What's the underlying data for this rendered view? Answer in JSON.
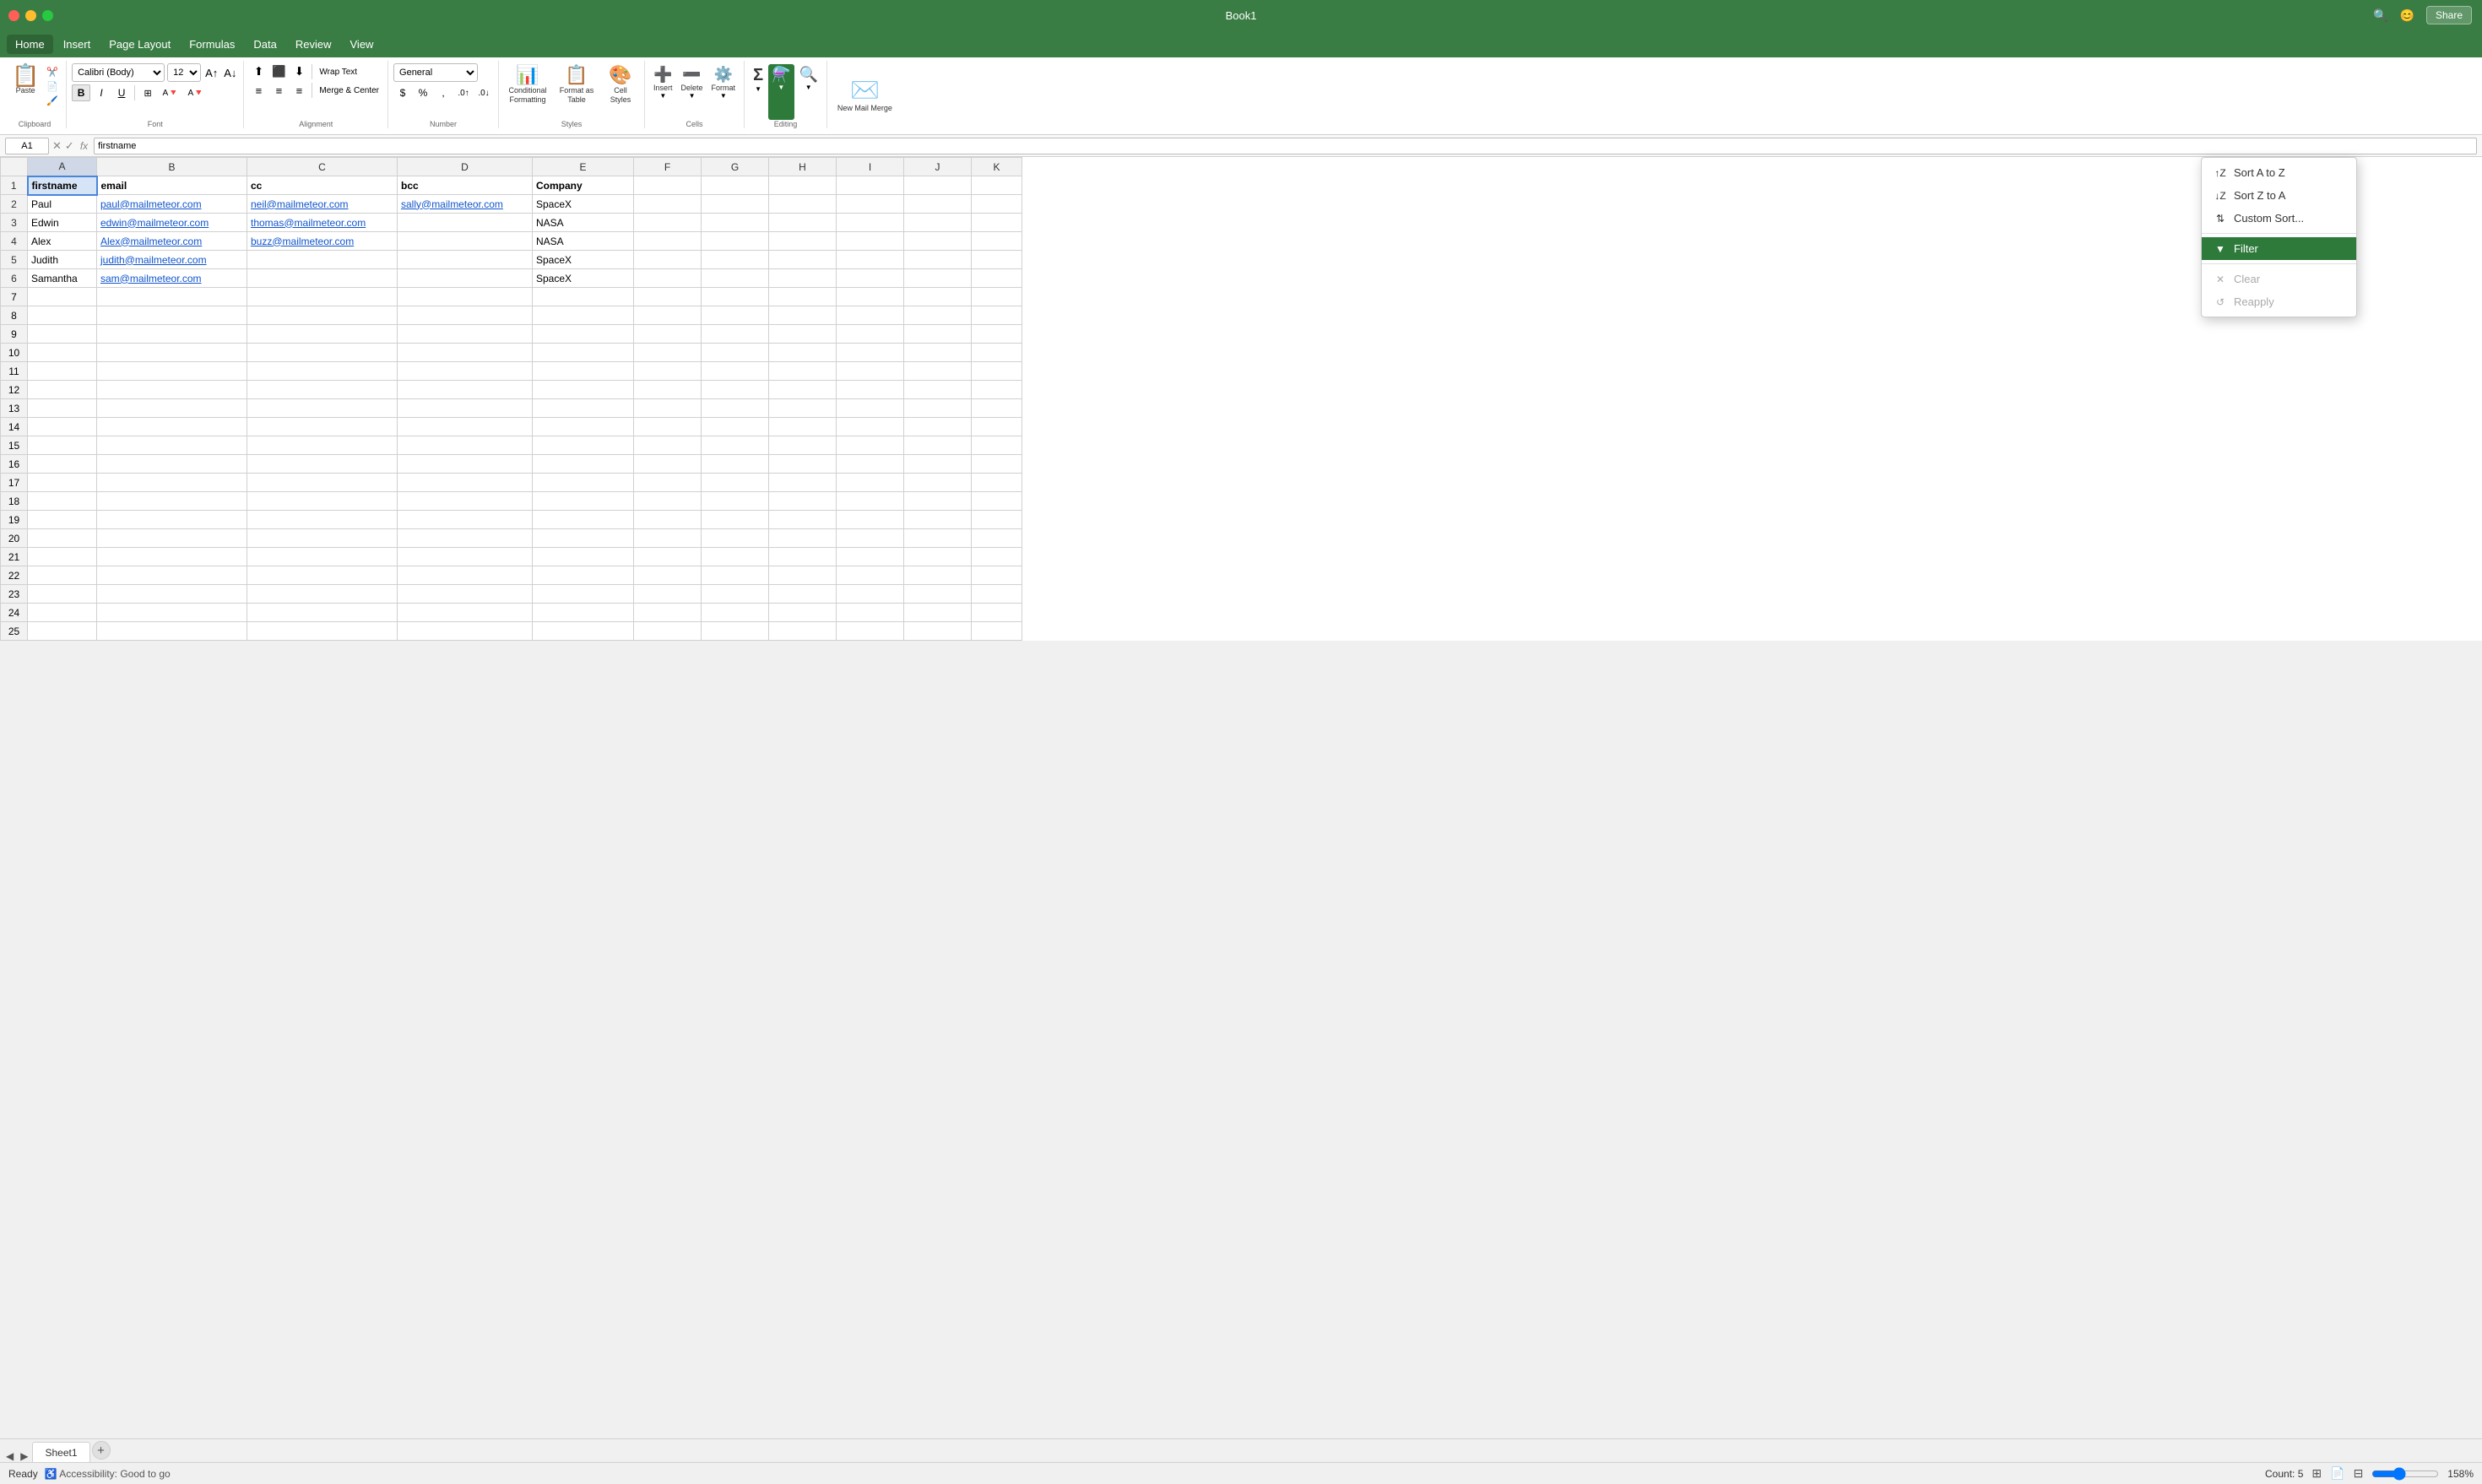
{
  "app": {
    "title": "Book1",
    "status": "Ready",
    "accessibility": "Accessibility: Good to go",
    "zoom": "158%",
    "count_label": "Count: 5"
  },
  "title_bar": {
    "close": "×",
    "minimize": "–",
    "maximize": "+",
    "share_label": "Share",
    "search_icon": "🔍"
  },
  "menu": {
    "items": [
      "Home",
      "Insert",
      "Page Layout",
      "Formulas",
      "Data",
      "Review",
      "View"
    ]
  },
  "ribbon": {
    "paste_label": "Paste",
    "clipboard_label": "Clipboard",
    "font_family": "Calibri (Body)",
    "font_size": "12",
    "bold_label": "B",
    "italic_label": "I",
    "underline_label": "U",
    "font_group_label": "Font",
    "alignment_group_label": "Alignment",
    "wrap_text_label": "Wrap Text",
    "merge_center_label": "Merge & Center",
    "number_format": "General",
    "number_group_label": "Number",
    "conditional_formatting_label": "Conditional Formatting",
    "format_as_table_label": "Format as Table",
    "cell_styles_label": "Cell Styles",
    "styles_group_label": "Styles",
    "insert_label": "Insert",
    "delete_label": "Delete",
    "format_label": "Format",
    "cells_group_label": "Cells",
    "sum_label": "Σ",
    "sort_filter_label": "Sort & Filter",
    "find_select_label": "Find & Select",
    "editing_group_label": "Editing",
    "new_mail_merge_label": "New Mail Merge"
  },
  "formula_bar": {
    "cell_ref": "A1",
    "fx": "fx",
    "formula_value": "firstname"
  },
  "columns": [
    "A",
    "B",
    "C",
    "D",
    "E",
    "F",
    "G",
    "H",
    "I",
    "J",
    "K"
  ],
  "rows": [
    {
      "num": 1,
      "cells": [
        "firstname",
        "email",
        "cc",
        "bcc",
        "Company",
        "",
        "",
        "",
        "",
        "",
        ""
      ]
    },
    {
      "num": 2,
      "cells": [
        "Paul",
        "paul@mailmeteor.com",
        "neil@mailmeteor.com",
        "sally@mailmeteor.com",
        "SpaceX",
        "",
        "",
        "",
        "",
        "",
        ""
      ]
    },
    {
      "num": 3,
      "cells": [
        "Edwin",
        "edwin@mailmeteor.com",
        "thomas@mailmeteor.com",
        "",
        "NASA",
        "",
        "",
        "",
        "",
        "",
        ""
      ]
    },
    {
      "num": 4,
      "cells": [
        "Alex",
        "Alex@mailmeteor.com",
        "buzz@mailmeteor.com",
        "",
        "NASA",
        "",
        "",
        "",
        "",
        "",
        ""
      ]
    },
    {
      "num": 5,
      "cells": [
        "Judith",
        "judith@mailmeteor.com",
        "",
        "",
        "SpaceX",
        "",
        "",
        "",
        "",
        "",
        ""
      ]
    },
    {
      "num": 6,
      "cells": [
        "Samantha",
        "sam@mailmeteor.com",
        "",
        "",
        "SpaceX",
        "",
        "",
        "",
        "",
        "",
        ""
      ]
    },
    {
      "num": 7,
      "cells": [
        "",
        "",
        "",
        "",
        "",
        "",
        "",
        "",
        "",
        "",
        ""
      ]
    },
    {
      "num": 8,
      "cells": [
        "",
        "",
        "",
        "",
        "",
        "",
        "",
        "",
        "",
        "",
        ""
      ]
    },
    {
      "num": 9,
      "cells": [
        "",
        "",
        "",
        "",
        "",
        "",
        "",
        "",
        "",
        "",
        ""
      ]
    },
    {
      "num": 10,
      "cells": [
        "",
        "",
        "",
        "",
        "",
        "",
        "",
        "",
        "",
        "",
        ""
      ]
    },
    {
      "num": 11,
      "cells": [
        "",
        "",
        "",
        "",
        "",
        "",
        "",
        "",
        "",
        "",
        ""
      ]
    },
    {
      "num": 12,
      "cells": [
        "",
        "",
        "",
        "",
        "",
        "",
        "",
        "",
        "",
        "",
        ""
      ]
    },
    {
      "num": 13,
      "cells": [
        "",
        "",
        "",
        "",
        "",
        "",
        "",
        "",
        "",
        "",
        ""
      ]
    },
    {
      "num": 14,
      "cells": [
        "",
        "",
        "",
        "",
        "",
        "",
        "",
        "",
        "",
        "",
        ""
      ]
    },
    {
      "num": 15,
      "cells": [
        "",
        "",
        "",
        "",
        "",
        "",
        "",
        "",
        "",
        "",
        ""
      ]
    },
    {
      "num": 16,
      "cells": [
        "",
        "",
        "",
        "",
        "",
        "",
        "",
        "",
        "",
        "",
        ""
      ]
    },
    {
      "num": 17,
      "cells": [
        "",
        "",
        "",
        "",
        "",
        "",
        "",
        "",
        "",
        "",
        ""
      ]
    },
    {
      "num": 18,
      "cells": [
        "",
        "",
        "",
        "",
        "",
        "",
        "",
        "",
        "",
        "",
        ""
      ]
    },
    {
      "num": 19,
      "cells": [
        "",
        "",
        "",
        "",
        "",
        "",
        "",
        "",
        "",
        "",
        ""
      ]
    },
    {
      "num": 20,
      "cells": [
        "",
        "",
        "",
        "",
        "",
        "",
        "",
        "",
        "",
        "",
        ""
      ]
    },
    {
      "num": 21,
      "cells": [
        "",
        "",
        "",
        "",
        "",
        "",
        "",
        "",
        "",
        "",
        ""
      ]
    },
    {
      "num": 22,
      "cells": [
        "",
        "",
        "",
        "",
        "",
        "",
        "",
        "",
        "",
        "",
        ""
      ]
    },
    {
      "num": 23,
      "cells": [
        "",
        "",
        "",
        "",
        "",
        "",
        "",
        "",
        "",
        "",
        ""
      ]
    },
    {
      "num": 24,
      "cells": [
        "",
        "",
        "",
        "",
        "",
        "",
        "",
        "",
        "",
        "",
        ""
      ]
    },
    {
      "num": 25,
      "cells": [
        "",
        "",
        "",
        "",
        "",
        "",
        "",
        "",
        "",
        "",
        ""
      ]
    }
  ],
  "email_cells": {
    "paul": "paul@mailmeteor.com",
    "edwin": "edwin@mailmeteor.com",
    "alex": "Alex@mailmeteor.com",
    "judith": "judith@mailmeteor.com",
    "sam": "sam@mailmeteor.com",
    "neil": "neil@mailmeteor.com",
    "thomas": "thomas@mailmeteor.com",
    "buzz": "buzz@mailmeteor.com",
    "sally": "sally@mailmeteor.com"
  },
  "sheet": {
    "tab_name": "Sheet1",
    "add_label": "+"
  },
  "dropdown": {
    "filter_label": "Filter",
    "sort_a_z": "Sort A to Z",
    "sort_z_a": "Sort Z to A",
    "custom_sort": "Custom Sort...",
    "clear": "Clear",
    "reapply": "Reapply"
  }
}
